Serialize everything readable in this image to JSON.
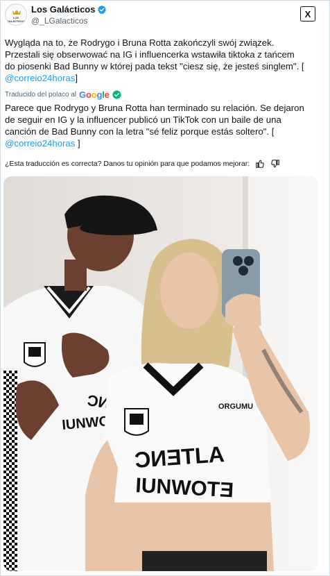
{
  "header": {
    "avatar_text": "LOS GALÁCTICOS",
    "display_name": "Los Galácticos",
    "handle": "@_LGalacticos",
    "verified_icon": "verified-badge-icon",
    "x_logo_text": "X",
    "brand_colors": {
      "verified": "#1d9bf0",
      "link": "#1d9bf0",
      "muted": "#536471"
    }
  },
  "tweet": {
    "polish": {
      "line1": "Wygląda na to, że Rodrygo i Bruna Rotta zakończyli swój związek.",
      "line2": "Przestali się obserwować na IG i influencerka wstawiła tiktoka z tańcem",
      "line3": "do piosenki Bad Bunny w której pada tekst \"ciesz się, że jesteś singlem\". [",
      "mention": "@correio24horas",
      "closing": "]"
    },
    "translation": {
      "label": "Traducido del polaco al",
      "provider": "Google",
      "line1": "Parece que Rodrygo y Bruna Rotta han terminado su relación. Se dejaron",
      "line2": "de seguir en IG y la influencer publicó un TikTok con un baile de una",
      "line3": "canción de Bad Bunny con la letra \"sé feliz porque estás soltero\". [",
      "mention": "@correio24horas",
      "closing": " ]"
    },
    "feedback": {
      "question": "¿Esta traducción es correcta? Danos tu opinión para que podamos mejorar:",
      "like_icon": "thumbs-up-icon",
      "dislike_icon": "thumbs-down-icon"
    }
  },
  "media": {
    "photo_description_icon": "photo-image",
    "shirt_text": "ORGUMU"
  }
}
